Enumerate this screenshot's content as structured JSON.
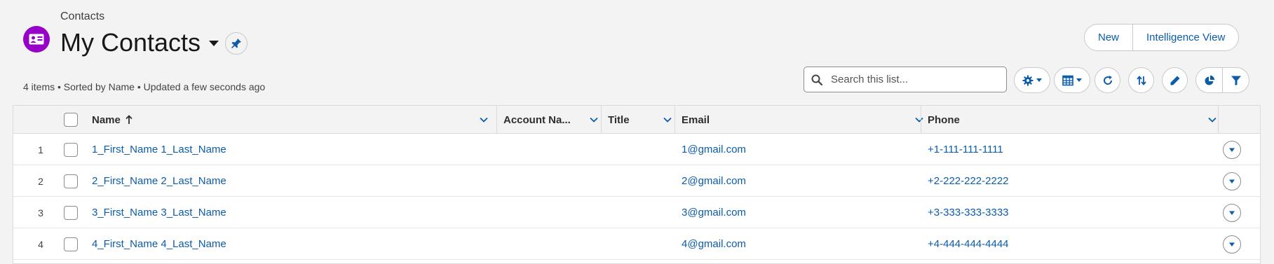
{
  "header": {
    "object_label": "Contacts",
    "list_title": "My Contacts",
    "app_icon": "contact-card-icon",
    "accent_color": "#9602c7"
  },
  "actions": {
    "new_label": "New",
    "intelligence_label": "Intelligence View"
  },
  "meta": {
    "summary": "4 items • Sorted by Name • Updated a few seconds ago"
  },
  "search": {
    "placeholder": "Search this list..."
  },
  "toolbar": {
    "icons": [
      "gear-icon",
      "table-icon",
      "refresh-icon",
      "sort-icon",
      "pencil-icon",
      "pie-chart-icon",
      "filter-icon"
    ]
  },
  "table": {
    "columns": [
      {
        "label": "Name",
        "sort": "ascending"
      },
      {
        "label": "Account Na..."
      },
      {
        "label": "Title"
      },
      {
        "label": "Email"
      },
      {
        "label": "Phone"
      }
    ],
    "rows": [
      {
        "num": "1",
        "name": "1_First_Name 1_Last_Name",
        "account": "",
        "title": "",
        "email": "1@gmail.com",
        "phone": "+1-111-111-1111"
      },
      {
        "num": "2",
        "name": "2_First_Name 2_Last_Name",
        "account": "",
        "title": "",
        "email": "2@gmail.com",
        "phone": "+2-222-222-2222"
      },
      {
        "num": "3",
        "name": "3_First_Name 3_Last_Name",
        "account": "",
        "title": "",
        "email": "3@gmail.com",
        "phone": "+3-333-333-3333"
      },
      {
        "num": "4",
        "name": "4_First_Name 4_Last_Name",
        "account": "",
        "title": "",
        "email": "4@gmail.com",
        "phone": "+4-444-444-4444"
      }
    ]
  }
}
